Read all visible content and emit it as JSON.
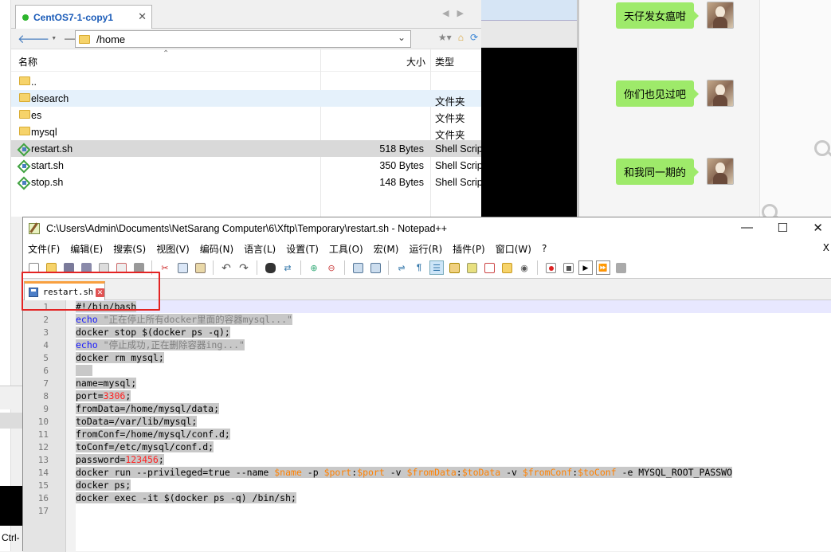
{
  "xftp": {
    "tab_label": "CentOS7-1-copy1",
    "path": "/home",
    "columns": {
      "name": "名称",
      "size": "大小",
      "type": "类型"
    },
    "files": [
      {
        "name": "..",
        "size": "",
        "type": "",
        "icon": "folder-icon"
      },
      {
        "name": "elsearch",
        "size": "",
        "type": "文件夹",
        "icon": "folder-icon"
      },
      {
        "name": "es",
        "size": "",
        "type": "文件夹",
        "icon": "folder-icon"
      },
      {
        "name": "mysql",
        "size": "",
        "type": "文件夹",
        "icon": "folder-icon"
      },
      {
        "name": "restart.sh",
        "size": "518 Bytes",
        "type": "Shell Script",
        "icon": "shell-script-icon"
      },
      {
        "name": "start.sh",
        "size": "350 Bytes",
        "type": "Shell Script",
        "icon": "shell-script-icon"
      },
      {
        "name": "stop.sh",
        "size": "148 Bytes",
        "type": "Shell Script",
        "icon": "shell-script-icon"
      }
    ]
  },
  "chat": {
    "messages": [
      "天仔发女瘟咁",
      "你们也见过吧",
      "和我同一期的"
    ],
    "bubble_color": "#9eea6a"
  },
  "notepad": {
    "title": "C:\\Users\\Admin\\Documents\\NetSarang Computer\\6\\Xftp\\Temporary\\restart.sh - Notepad++",
    "menu": [
      "文件(F)",
      "编辑(E)",
      "搜索(S)",
      "视图(V)",
      "编码(N)",
      "语言(L)",
      "设置(T)",
      "工具(O)",
      "宏(M)",
      "运行(R)",
      "插件(P)",
      "窗口(W)",
      "?"
    ],
    "menu_close": "X",
    "tab_name": "restart.sh",
    "line_numbers": [
      "1",
      "2",
      "3",
      "4",
      "5",
      "6",
      "7",
      "8",
      "9",
      "10",
      "11",
      "12",
      "13",
      "14",
      "15",
      "16",
      "17"
    ],
    "code": {
      "l1": "#!/bin/bash",
      "l2_kw": "echo",
      "l2_str": "\"正在停止所有docker里面的容器mysql...\"",
      "l3": "docker stop $(docker ps -q);",
      "l4_kw": "echo",
      "l4_str": "\"停止成功,正在删除容器ing...\"",
      "l5": "docker rm mysql;",
      "l7": "name=mysql;",
      "l8_a": "port=",
      "l8_num": "3306",
      "l8_b": ";",
      "l9": "fromData=/home/mysql/data;",
      "l10": "toData=/var/lib/mysql;",
      "l11": "fromConf=/home/mysql/conf.d;",
      "l12": "toConf=/etc/mysql/conf.d;",
      "l13_a": "password=",
      "l13_num": "123456",
      "l13_b": ";",
      "l14_a": "docker run --privileged=true --name ",
      "l14_v1": "$name",
      "l14_b": " -p ",
      "l14_v2": "$port",
      "l14_c": ":",
      "l14_v3": "$port",
      "l14_d": " -v ",
      "l14_v4": "$fromData",
      "l14_e": ":",
      "l14_v5": "$toData",
      "l14_f": " -v ",
      "l14_v6": "$fromConf",
      "l14_g": ":",
      "l14_v7": "$toConf",
      "l14_h": " -e MYSQL_ROOT_PASSWO",
      "l15": "docker ps;",
      "l16": "docker exec -it $(docker ps -q) /bin/sh;"
    }
  },
  "footer": {
    "ctrl_text": "Ctrl-"
  },
  "colors": {
    "highlight_box": "#e32323",
    "keyword": "#1818ff",
    "number": "#ff2020",
    "variable": "#ff8000"
  }
}
